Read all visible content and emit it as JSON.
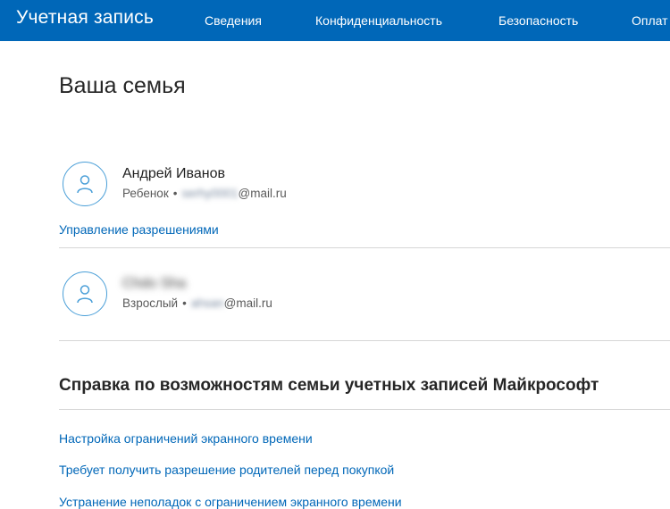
{
  "header": {
    "brand": "Учетная запись",
    "nav": [
      {
        "label": "Сведения"
      },
      {
        "label": "Конфиденциальность"
      },
      {
        "label": "Безопасность"
      },
      {
        "label": "Оплат"
      }
    ]
  },
  "page": {
    "title": "Ваша семья"
  },
  "members": [
    {
      "name": "Андрей Иванов",
      "role": "Ребенок",
      "separator": "•",
      "email_hidden": "serhy0001",
      "email_domain": "@mail.ru",
      "manage_link": "Управление разрешениями"
    },
    {
      "name": "Chdo Sha",
      "role": "Взрослый",
      "separator": "•",
      "email_hidden": "ahsan",
      "email_domain": "@mail.ru"
    }
  ],
  "help": {
    "title": "Справка по возможностям семьи учетных записей Майкрософт",
    "links": [
      "Настройка ограничений экранного времени",
      "Требует получить разрешение родителей перед покупкой",
      "Устранение неполадок с ограничением экранного времени"
    ]
  },
  "colors": {
    "accent": "#0067b8",
    "avatar_ring": "#4a9fd8"
  }
}
